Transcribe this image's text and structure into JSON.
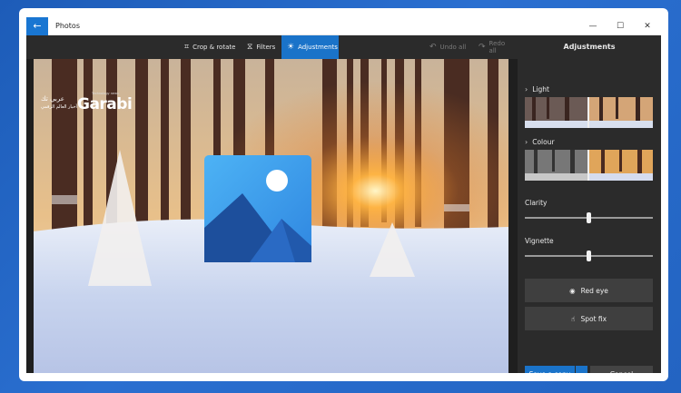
{
  "window": {
    "title": "Photos",
    "back_icon": "←",
    "controls": {
      "minimize": "—",
      "maximize": "☐",
      "close": "✕"
    }
  },
  "toolbar": {
    "crop_label": "Crop & rotate",
    "crop_icon": "⌗",
    "filters_label": "Filters",
    "filters_icon": "⧖",
    "adjustments_label": "Adjustments",
    "adjustments_icon": "☀",
    "undo_label": "Undo all",
    "undo_icon": "↶",
    "redo_label": "Redo all",
    "redo_icon": "↷",
    "active_tab": "Adjustments"
  },
  "overlay": {
    "arabic_name": "عربي تك",
    "arabic_tagline": "أخبار العالم الرقمي",
    "brand": "Garabi",
    "brand_tag": "Technology news"
  },
  "zoom": {
    "fit_icon": "⛶",
    "minus": "—",
    "plus": "+"
  },
  "panel": {
    "title": "Adjustments",
    "light_label": "Light",
    "colour_label": "Colour",
    "clarity_label": "Clarity",
    "clarity_level": 0.5,
    "vignette_label": "Vignette",
    "vignette_level": 0.5,
    "red_eye_label": "Red eye",
    "red_eye_icon": "◉",
    "spot_fix_label": "Spot fix",
    "spot_fix_icon": "☝",
    "save_label": "Save a copy",
    "save_drop_icon": "⌄",
    "cancel_label": "Cancel",
    "chevron_icon": "›"
  },
  "colors": {
    "accent": "#1a73c9",
    "panel_bg": "#2b2b2b",
    "page_bg": "#2364c2"
  }
}
